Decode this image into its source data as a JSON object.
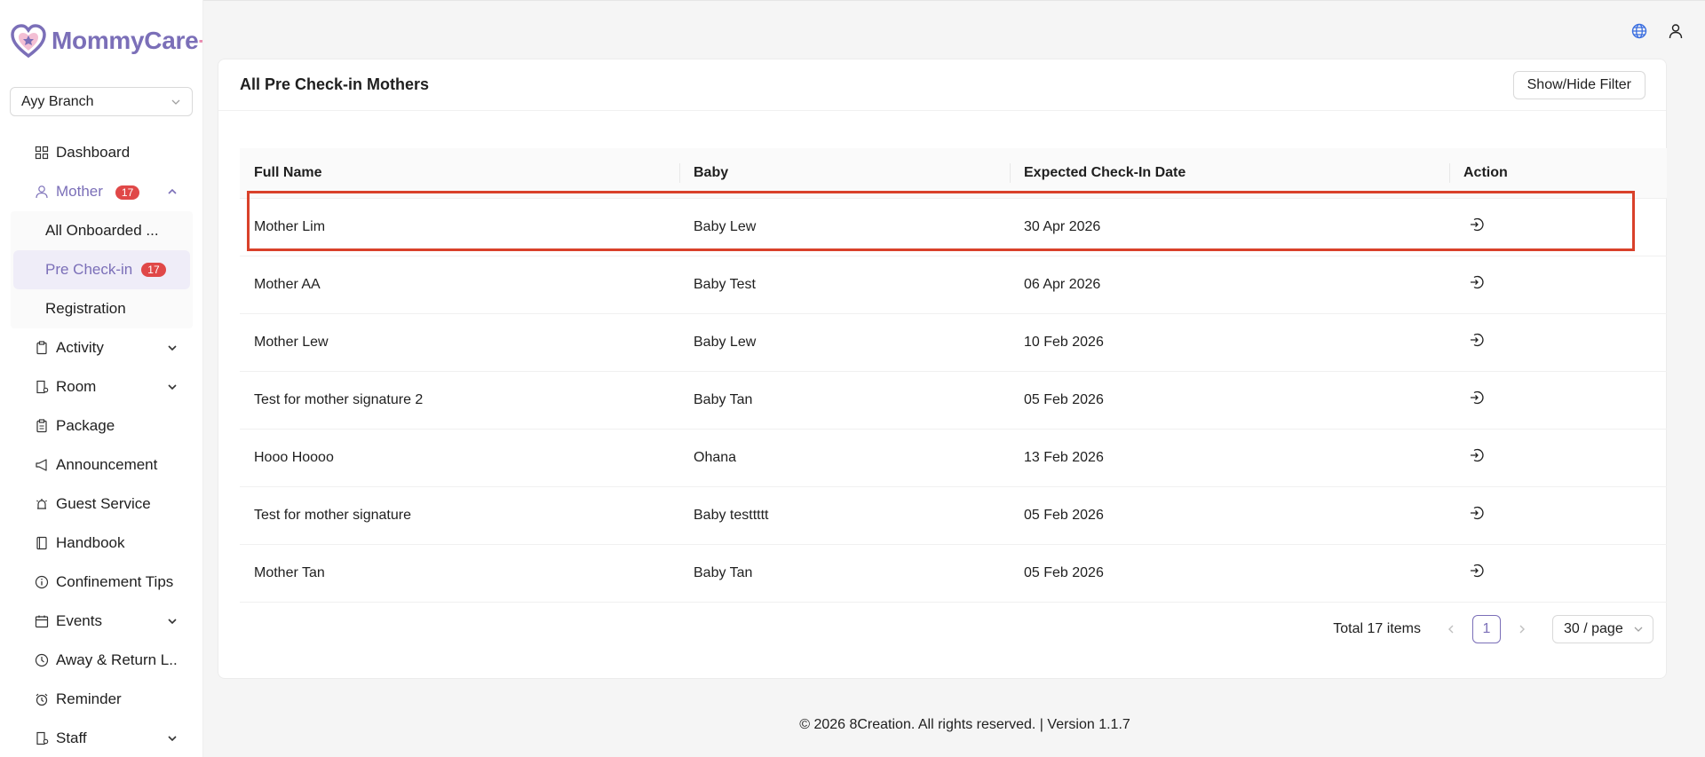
{
  "app": {
    "name": "MommyCare",
    "plus": "+"
  },
  "branch": {
    "selected": "Ayy Branch"
  },
  "colors": {
    "accent": "#7b6fb8",
    "badge": "#e04848",
    "highlight": "#d9412a"
  },
  "sidebar": {
    "items": [
      {
        "label": "Dashboard",
        "icon": "dashboard-icon"
      },
      {
        "label": "Mother",
        "icon": "user-icon",
        "badge": "17",
        "expanded": true,
        "children": [
          {
            "label": "All Onboarded ..."
          },
          {
            "label": "Pre Check-in",
            "badge": "17",
            "selected": true
          },
          {
            "label": "Registration"
          }
        ]
      },
      {
        "label": "Activity",
        "icon": "clipboard-icon",
        "has_children": true
      },
      {
        "label": "Room",
        "icon": "room-icon",
        "has_children": true
      },
      {
        "label": "Package",
        "icon": "package-icon"
      },
      {
        "label": "Announcement",
        "icon": "megaphone-icon"
      },
      {
        "label": "Guest Service",
        "icon": "bell-icon"
      },
      {
        "label": "Handbook",
        "icon": "book-icon"
      },
      {
        "label": "Confinement Tips",
        "icon": "info-icon"
      },
      {
        "label": "Events",
        "icon": "calendar-icon",
        "has_children": true
      },
      {
        "label": "Away & Return L...",
        "icon": "clock-icon"
      },
      {
        "label": "Reminder",
        "icon": "alarm-icon"
      },
      {
        "label": "Staff",
        "icon": "staff-icon",
        "has_children": true
      }
    ]
  },
  "header": {
    "globe_icon": "globe-icon",
    "user_icon": "user-icon"
  },
  "card": {
    "title": "All Pre Check-in Mothers",
    "filter_button": "Show/Hide Filter"
  },
  "table": {
    "columns": [
      "Full Name",
      "Baby",
      "Expected Check-In Date",
      "Action"
    ],
    "rows": [
      {
        "full_name": "Mother Lim",
        "baby": "Baby Lew",
        "date": "30 Apr 2026"
      },
      {
        "full_name": "Mother AA",
        "baby": "Baby Test",
        "date": "06 Apr 2026"
      },
      {
        "full_name": "Mother Lew",
        "baby": "Baby Lew",
        "date": "10 Feb 2026"
      },
      {
        "full_name": "Test for mother signature 2",
        "baby": "Baby Tan",
        "date": "05 Feb 2026"
      },
      {
        "full_name": "Hooo Hoooo",
        "baby": "Ohana",
        "date": "13 Feb 2026"
      },
      {
        "full_name": "Test for mother signature",
        "baby": "Baby testtttt",
        "date": "05 Feb 2026"
      },
      {
        "full_name": "Mother Tan",
        "baby": "Baby Tan",
        "date": "05 Feb 2026"
      }
    ]
  },
  "pagination": {
    "total": "Total 17 items",
    "current_page": "1",
    "page_size": "30 / page"
  },
  "footer": {
    "text": "© 2026 8Creation. All rights reserved. | Version 1.1.7"
  }
}
